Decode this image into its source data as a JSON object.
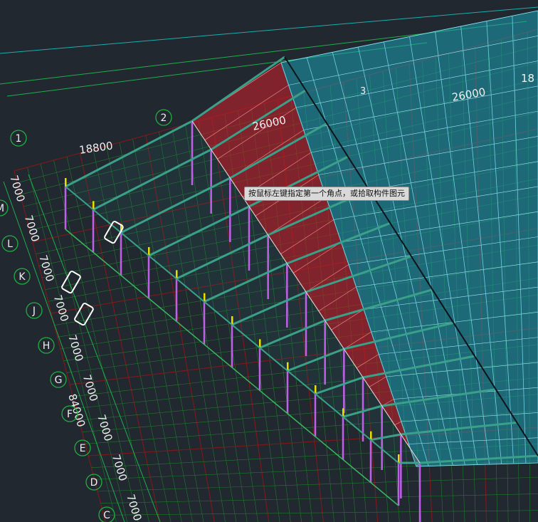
{
  "tooltip": "按鼠标左键指定第一个角点，或拾取构件图元",
  "dimensions": {
    "span_left": "18800",
    "span_mid": "26000",
    "span_mid_top": "26000",
    "span_right_partial": "18",
    "total_bays": "84000",
    "bay": "7000",
    "mark_3": "3"
  },
  "grid_axes_top": [
    "1",
    "2"
  ],
  "grid_axes_left": [
    "M",
    "L",
    "K",
    "J",
    "H",
    "G",
    "F",
    "E",
    "D",
    "C"
  ],
  "colors": {
    "background": "#212830",
    "red_grid": "#7a1a1a",
    "green_grid": "#1f7a2a",
    "column": "#c060e8",
    "beam": "#3aa08a",
    "red_roof": "#c0202a",
    "blue_roof": "#1e9fb5",
    "yellow_marker": "#e8e000"
  },
  "icons": [
    "grid-bubble-icon",
    "column-top-marker-icon"
  ]
}
